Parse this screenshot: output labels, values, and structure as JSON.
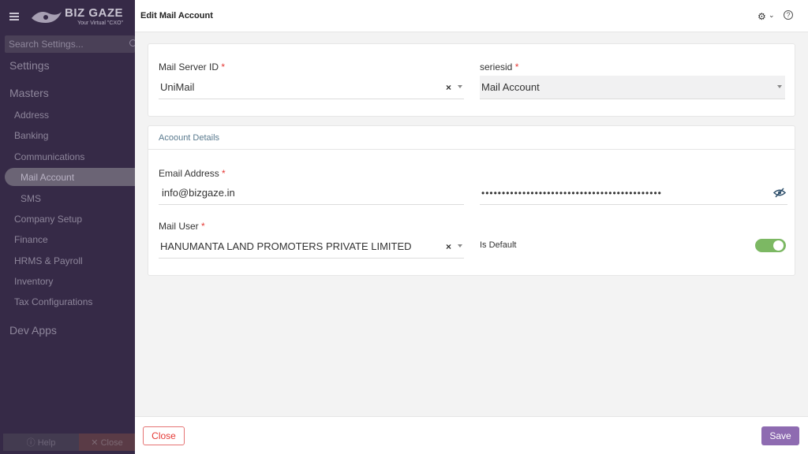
{
  "brand": {
    "name": "BIZ GAZE",
    "tagline": "Your Virtual \"CXO\""
  },
  "sidebar": {
    "search_placeholder": "Search Settings...",
    "settings_heading": "Settings",
    "masters_heading": "Masters",
    "items": [
      "Address",
      "Banking",
      "Communications"
    ],
    "sub_items": [
      "Mail Account",
      "SMS"
    ],
    "items2": [
      "Company Setup",
      "Finance",
      "HRMS & Payroll",
      "Inventory",
      "Tax Configurations"
    ],
    "dev_heading": "Dev Apps",
    "help_label": "ⓘ Help",
    "close_label": "✕ Close"
  },
  "header": {
    "title": "Edit Mail Account"
  },
  "form": {
    "mail_server_label": "Mail Server ID",
    "mail_server_value": "UniMail",
    "seriesid_label": "seriesid",
    "seriesid_value": "Mail Account",
    "section_title": "Acoount Details",
    "email_label": "Email Address",
    "email_value": "info@bizgaze.in",
    "password_masked": "••••••••••••••••••••••••••••••••••••••••••••",
    "mail_user_label": "Mail User",
    "mail_user_value": "HANUMANTA LAND PROMOTERS PRIVATE LIMITED",
    "is_default_label": "Is Default",
    "is_default": true,
    "required_mark": "*",
    "clear_glyph": "×"
  },
  "footer": {
    "close_label": "Close",
    "save_label": "Save"
  },
  "colors": {
    "sidebar_bg": "#362a47",
    "accent": "#8e6bb1",
    "toggle_on": "#7cb863",
    "danger": "#e53935"
  }
}
